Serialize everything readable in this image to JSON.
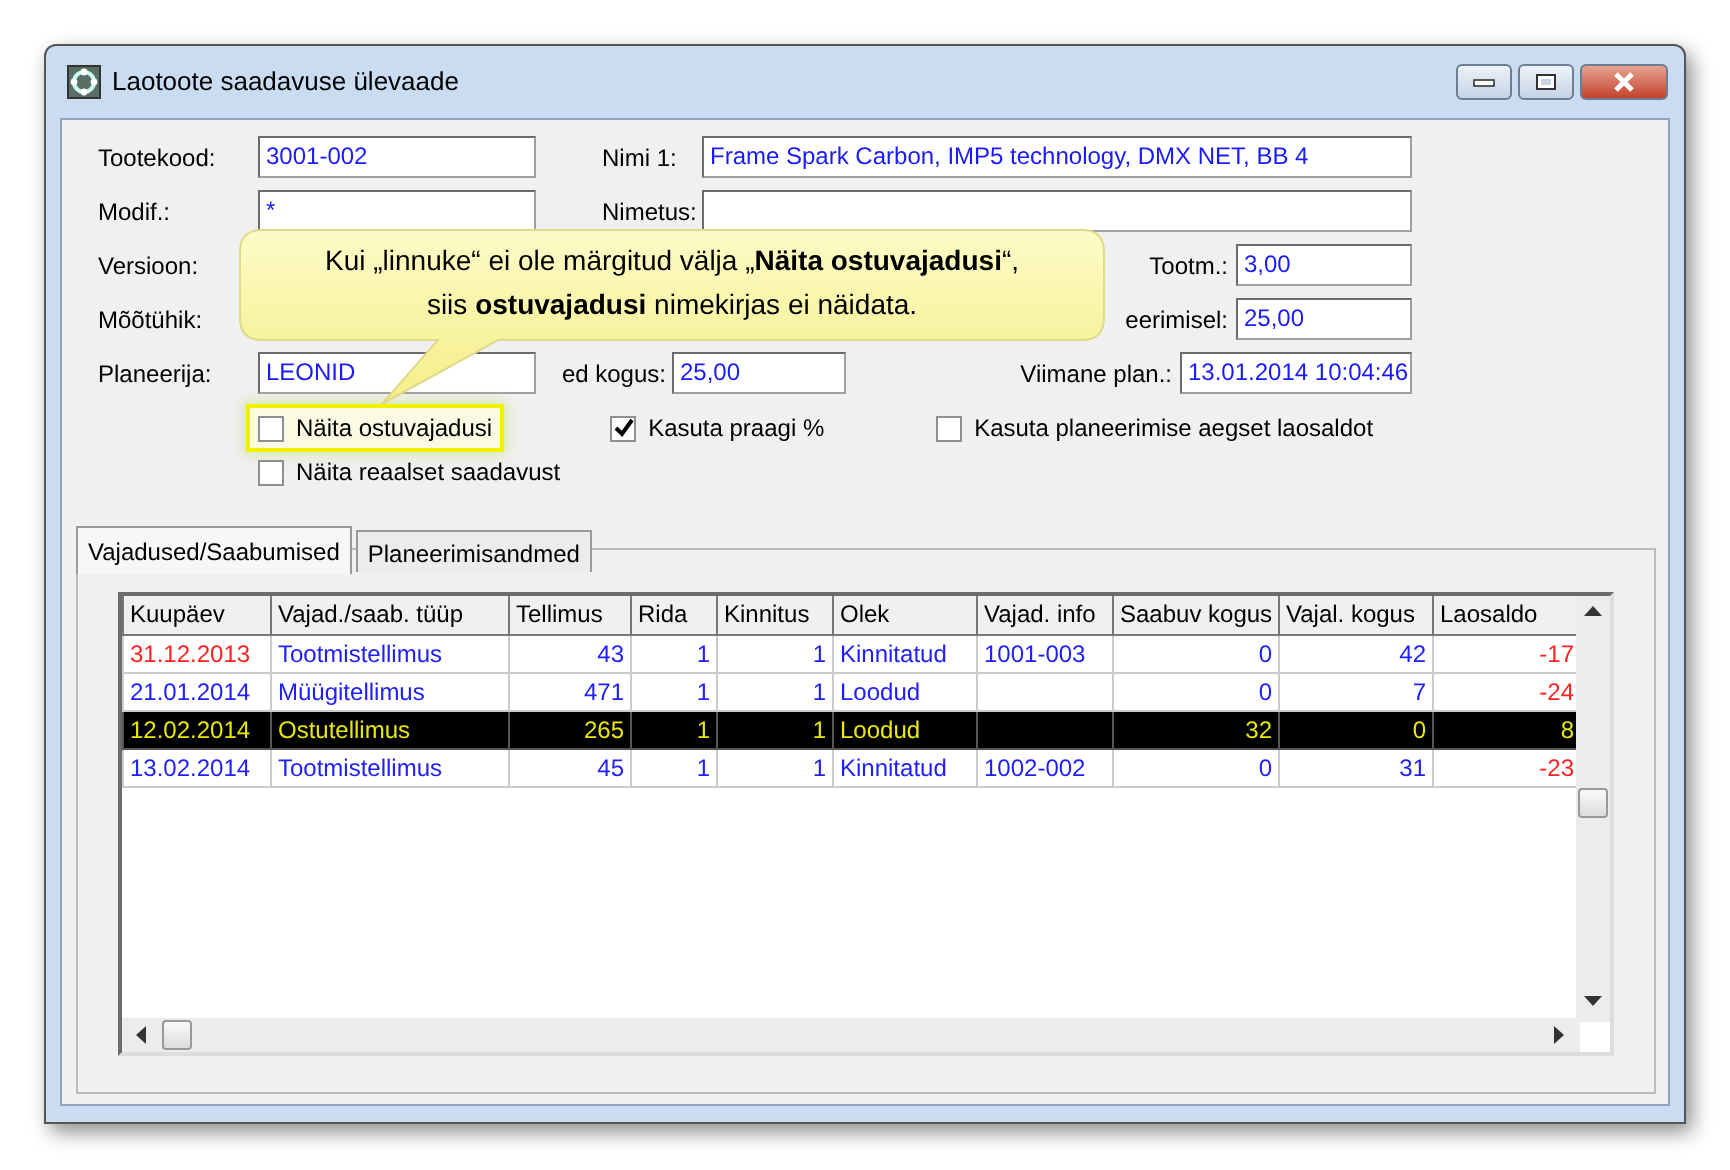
{
  "window": {
    "title": "Laotoote saadavuse ülevaade"
  },
  "form_rows": [
    [
      {
        "kind": "main",
        "label": "Tootekood:",
        "value": "3001-002"
      },
      {
        "kind": "name",
        "label": "Nimi 1:",
        "value": "Frame Spark Carbon, IMP5 technology, DMX NET, BB 4"
      }
    ],
    [
      {
        "kind": "main",
        "label": "Modif.:",
        "value": "*"
      },
      {
        "kind": "name",
        "label": "Nimetus:"
      }
    ],
    [
      {
        "kind": "main",
        "label": "Versioon:"
      },
      {
        "kind": "side",
        "label": "Tootm.:",
        "value": "3,00"
      }
    ],
    [
      {
        "kind": "main",
        "label": "Mõõtühik:"
      },
      {
        "kind": "side",
        "label": "eerimisel:",
        "value": "25,00"
      }
    ],
    [
      {
        "kind": "main",
        "label": "Planeerija:",
        "value": "LEONID"
      },
      {
        "kind": "mid",
        "label": "ed kogus:",
        "value": "25,00"
      },
      {
        "kind": "last",
        "label": "Viimane plan.:",
        "value": "13.01.2014 10:04:46"
      }
    ]
  ],
  "checkbox_rows": [
    [
      {
        "label": "Näita ostuvajadusi",
        "checked": false,
        "highlighted": true
      },
      {
        "label": "Kasuta praagi %",
        "checked": true,
        "highlighted": false
      },
      {
        "label": "Kasuta planeerimise aegset laosaldot",
        "checked": false,
        "highlighted": false
      }
    ],
    [
      {
        "label": "Näita reaalset saadavust",
        "checked": false,
        "highlighted": false
      }
    ]
  ],
  "callout": {
    "lines": [
      "Kui „linnuke“ ei ole märgitud välja „**Näita ostuvajadusi**“,",
      "siis **ostuvajadusi** nimekirjas ei näidata."
    ]
  },
  "tabs": [
    {
      "label": "Vajadused/Saabumised",
      "selected": true
    },
    {
      "label": "Planeerimisandmed",
      "selected": false
    }
  ],
  "table": {
    "columns": [
      "Kuupäev",
      "Vajad./saab. tüüp",
      "Tellimus",
      "Rida",
      "Kinnitus",
      "Olek",
      "Vajad. info",
      "Saabuv kogus",
      "Vajal. kogus",
      "Laosaldo"
    ],
    "rows": [
      {
        "selected": false,
        "overdue": true,
        "shortage": true,
        "cells": [
          "31.12.2013",
          "Tootmistellimus",
          "43",
          "1",
          "1",
          "Kinnitatud",
          "1001-003",
          "0",
          "42",
          "-17"
        ]
      },
      {
        "selected": false,
        "overdue": false,
        "shortage": true,
        "cells": [
          "21.01.2014",
          "Müügitellimus",
          "471",
          "1",
          "1",
          "Loodud",
          "",
          "0",
          "7",
          "-24"
        ]
      },
      {
        "selected": true,
        "overdue": false,
        "shortage": false,
        "cells": [
          "12.02.2014",
          "Ostutellimus",
          "265",
          "1",
          "1",
          "Loodud",
          "",
          "32",
          "0",
          "8"
        ]
      },
      {
        "selected": false,
        "overdue": false,
        "shortage": true,
        "cells": [
          "13.02.2014",
          "Tootmistellimus",
          "45",
          "1",
          "1",
          "Kinnitatud",
          "1002-002",
          "0",
          "31",
          "-23"
        ]
      }
    ]
  }
}
